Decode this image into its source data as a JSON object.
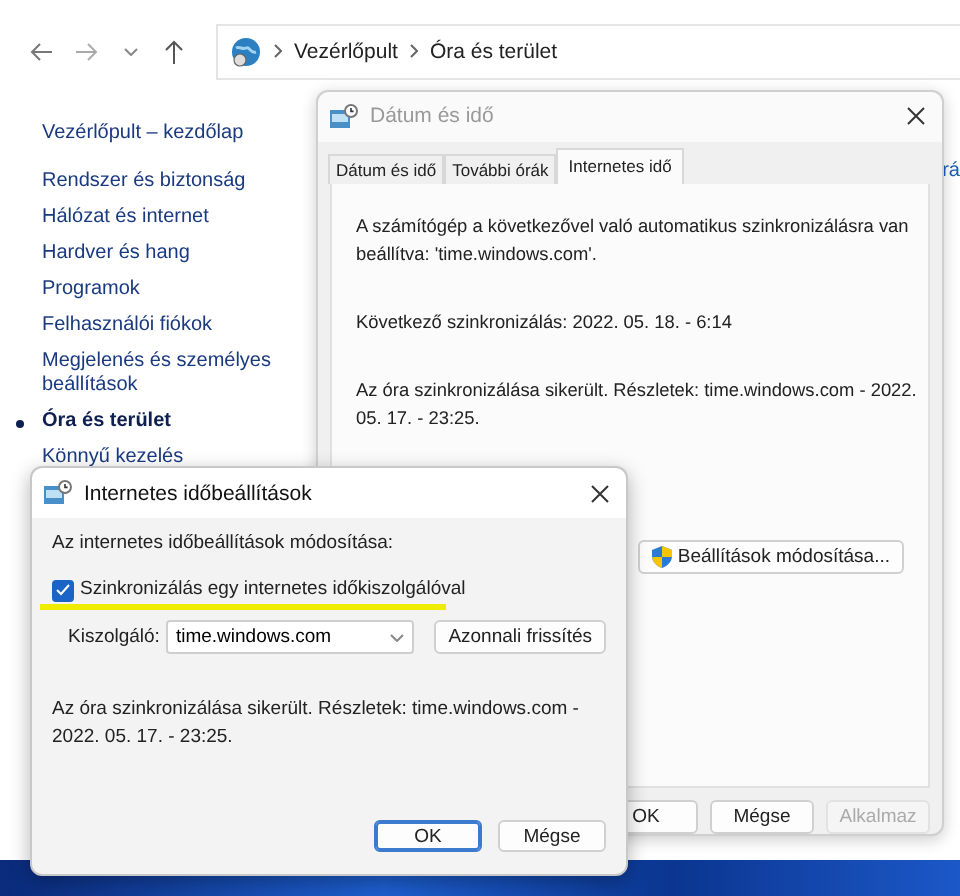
{
  "explorer": {
    "breadcrumbs": [
      "Vezérlőpult",
      "Óra és terület"
    ],
    "sidebar": {
      "items": [
        {
          "label": "Vezérlőpult – kezdőlap",
          "selected": false
        },
        {
          "label": "Rendszer és biztonság",
          "selected": false
        },
        {
          "label": "Hálózat és internet",
          "selected": false
        },
        {
          "label": "Hardver és hang",
          "selected": false
        },
        {
          "label": "Programok",
          "selected": false
        },
        {
          "label": "Felhasználói fiókok",
          "selected": false
        },
        {
          "label": "Megjelenés és személyes beállítások",
          "selected": false
        },
        {
          "label": "Óra és terület",
          "selected": true
        },
        {
          "label": "Könnyű kezelés",
          "selected": false
        }
      ]
    },
    "content_link": "rá"
  },
  "date_dialog": {
    "title": "Dátum és idő",
    "tabs": [
      {
        "label": "Dátum és idő",
        "selected": false
      },
      {
        "label": "További órák",
        "selected": false
      },
      {
        "label": "Internetes idő",
        "selected": true
      }
    ],
    "paragraphs": [
      "A számítógép a következővel való automatikus szinkronizálásra van beállítva: 'time.windows.com'.",
      "Következő szinkronizálás: 2022. 05. 18. - 6:14",
      "Az óra szinkronizálása sikerült. Részletek: time.windows.com - 2022. 05. 17. - 23:25."
    ],
    "change_button": "Beállítások módosítása...",
    "buttons": [
      {
        "label": "OK",
        "disabled": false
      },
      {
        "label": "Mégse",
        "disabled": false
      },
      {
        "label": "Alkalmaz",
        "disabled": true
      }
    ]
  },
  "internet_dialog": {
    "title": "Internetes időbeállítások",
    "intro": "Az internetes időbeállítások módosítása:",
    "sync": {
      "label": "Szinkronizálás egy internetes időkiszolgálóval",
      "checked": true
    },
    "server": {
      "label": "Kiszolgáló:",
      "value": "time.windows.com"
    },
    "update_button": "Azonnali frissítés",
    "status": "Az óra szinkronizálása sikerült. Részletek: time.windows.com - 2022. 05. 17. - 23:25.",
    "buttons": [
      {
        "label": "OK",
        "default": true
      },
      {
        "label": "Mégse",
        "default": false
      }
    ]
  }
}
